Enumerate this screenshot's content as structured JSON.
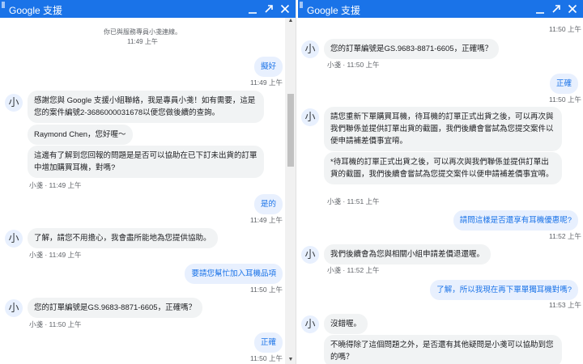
{
  "window": {
    "title": "Google 支援",
    "minimize_icon": "minimize-icon",
    "expand_icon": "expand-icon",
    "close_icon": "close-icon",
    "accent": "#1a73e8"
  },
  "left": {
    "system": {
      "text": "你已與服務專員小戔連線。",
      "time": "11:49 上午"
    },
    "m1": {
      "text": "擬好",
      "time": "11:49 上午"
    },
    "m2": {
      "avatar": "小",
      "text1": "感謝您與 Google 支援小組聯絡，我是專員小戔！如有需要，這是您的案件編號2-3686000031678以便您做後續的查詢。",
      "text2": "Raymond Chen，您好喔～",
      "text3": "這邊有了解到您回報的問題是是否可以協助在已下訂未出貨的訂單中增加購買耳機，對嗎?",
      "meta": "小戔 · 11:49 上午"
    },
    "m3": {
      "text": "是的",
      "time": "11:49 上午"
    },
    "m4": {
      "avatar": "小",
      "text": "了解，請您不用擔心，我會盡所能地為您提供協助。",
      "meta": "小戔 · 11:49 上午"
    },
    "m5": {
      "text": "要請您幫忙加入耳機品項",
      "time": "11:50 上午"
    },
    "m6": {
      "avatar": "小",
      "text": "您的訂單編號是GS.9683-8871-6605，正確嗎？",
      "meta": "小戔 · 11:50 上午"
    },
    "m7": {
      "text": "正確",
      "time": "11:50 上午"
    }
  },
  "right": {
    "top_time": "11:50 上午",
    "r1": {
      "avatar": "小",
      "text": "您的訂單編號是GS.9683-8871-6605，正確嗎？",
      "meta": "小戔 · 11:50 上午"
    },
    "r2": {
      "text": "正確",
      "time": "11:50 上午"
    },
    "r3": {
      "avatar": "小",
      "text1": "請您重新下單購買耳機，待耳機的訂單正式出貨之後，可以再次與我們聯係並提供訂單出貨的截圖，我們後續會嘗試為您提交案件以便申請補差價事宜唷。",
      "text2": "*待耳機的訂單正式出貨之後，可以再次與我們聯係並提供訂單出貨的截圖，我們後續會嘗試為您提交案件以便申請補差價事宜唷。",
      "meta": "小戔 · 11:51 上午"
    },
    "r4": {
      "text": "請問這樣是否還享有耳機優惠呢?",
      "time": "11:52 上午"
    },
    "r5": {
      "avatar": "小",
      "text": "我們後續會為您與相關小組申請差價退還喔。",
      "meta": "小戔 · 11:52 上午"
    },
    "r6": {
      "text": "了解，所以我現在再下單單獨耳機對嗎?",
      "time": "11:53 上午"
    },
    "r7": {
      "avatar": "小",
      "text": "沒錯喔。"
    },
    "r8": {
      "text": "不曉得除了這個問題之外，是否還有其他疑問是小戔可以協助到您的嗎？"
    }
  }
}
